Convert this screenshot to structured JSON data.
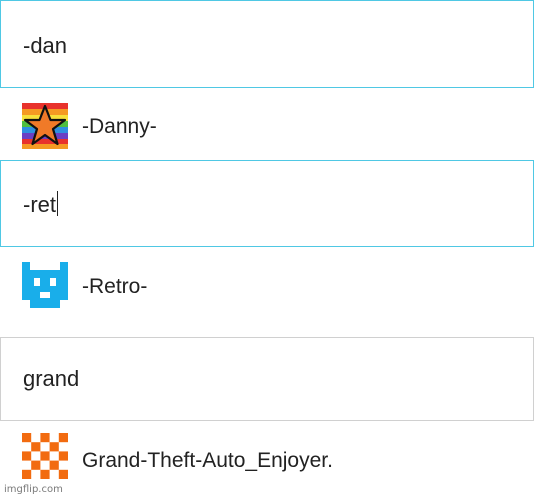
{
  "colors": {
    "focused_border": "#4fc8e4",
    "idle_border": "#d0d0d0",
    "retro_blue": "#19aeea",
    "gta_orange": "#f26b10",
    "star_orange": "#f07a28"
  },
  "searches": [
    {
      "query": "-dan",
      "focused": true,
      "result": {
        "name": "-Danny-",
        "avatar_icon": "rainbow-star-icon"
      }
    },
    {
      "query": "-ret",
      "focused": true,
      "caret_visible": true,
      "result": {
        "name": "-Retro-",
        "avatar_icon": "blue-pixel-cat-icon"
      }
    },
    {
      "query": "grand",
      "focused": false,
      "result": {
        "name": "Grand-Theft-Auto_Enjoyer.",
        "avatar_icon": "orange-pixel-checker-icon"
      }
    }
  ],
  "watermark": "imgflip.com"
}
